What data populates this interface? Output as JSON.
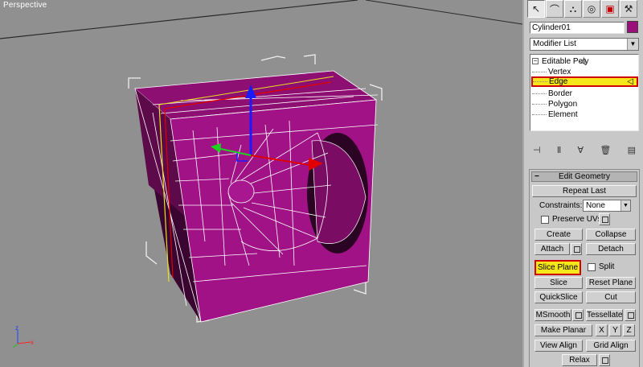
{
  "viewport": {
    "label": "Perspective"
  },
  "command_panel": {
    "tabs": [
      {
        "icon": "create-cursor-icon",
        "glyph": "↖"
      },
      {
        "icon": "modify-icon",
        "glyph": "⌒"
      },
      {
        "icon": "hierarchy-icon",
        "glyph": "⛬"
      },
      {
        "icon": "motion-icon",
        "glyph": "◎"
      },
      {
        "icon": "display-icon",
        "glyph": "▣"
      },
      {
        "icon": "utilities-icon",
        "glyph": "⚒"
      }
    ],
    "object_name": "Cylinder01",
    "object_color": "#9a0f7a",
    "modifier_list": "Modifier List",
    "stack": {
      "root": "Editable Poly",
      "items": [
        "Vertex",
        "Edge",
        "Border",
        "Polygon",
        "Element"
      ],
      "selected": "Edge"
    },
    "edit_geometry": {
      "title": "Edit Geometry",
      "repeat_last": "Repeat Last",
      "constraints_label": "Constraints:",
      "constraints_value": "None",
      "preserve_uvs": "Preserve UVs",
      "create": "Create",
      "collapse": "Collapse",
      "attach": "Attach",
      "detach": "Detach",
      "slice_plane": "Slice Plane",
      "split": "Split",
      "slice": "Slice",
      "reset_plane": "Reset Plane",
      "quickslice": "QuickSlice",
      "cut": "Cut",
      "msmooth": "MSmooth",
      "tessellate": "Tessellate",
      "make_planar": "Make Planar",
      "x": "X",
      "y": "Y",
      "z": "Z",
      "view_align": "View Align",
      "grid_align": "Grid Align",
      "relax": "Relax"
    }
  },
  "colors": {
    "mesh": "#a01285",
    "highlight": "#f5e71a",
    "highlight_border": "#d00000"
  }
}
